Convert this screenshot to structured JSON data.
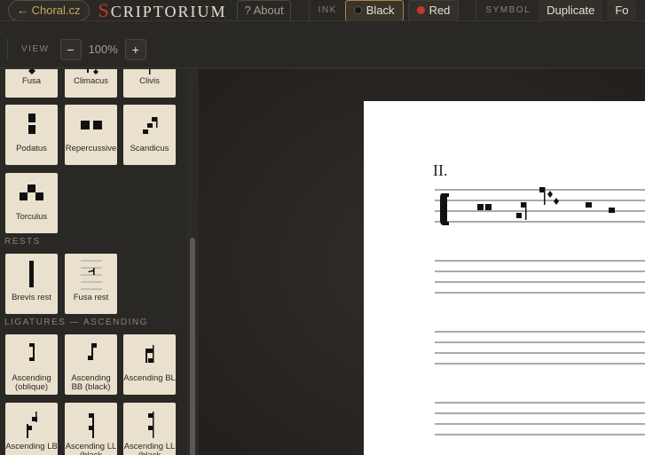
{
  "topbar": {
    "back_label": "← Choral.cz",
    "brand_first": "S",
    "brand_rest": "CRIPTORIUM",
    "about_label": "? About",
    "ink_label": "INK",
    "ink_black": "Black",
    "ink_red": "Red",
    "symbol_label": "SYMBOL",
    "duplicate_label": "Duplicate",
    "fo_label": "Fo"
  },
  "viewbar": {
    "view_label": "VIEW",
    "zoom_out": "−",
    "zoom_value": "100%",
    "zoom_in": "+"
  },
  "palette": {
    "neumes": [
      {
        "name": "Fusa",
        "icon": "fusa-icon"
      },
      {
        "name": "Climacus",
        "icon": "climacus-icon"
      },
      {
        "name": "Clivis",
        "icon": "clivis-icon"
      },
      {
        "name": "Podatus",
        "icon": "podatus-icon"
      },
      {
        "name": "Repercussive",
        "icon": "repercussive-icon"
      },
      {
        "name": "Scandicus",
        "icon": "scandicus-icon"
      },
      {
        "name": "Torculus",
        "icon": "torculus-icon"
      }
    ],
    "rests_label": "RESTS",
    "rests": [
      {
        "name": "Brevis rest",
        "icon": "brevis-rest-icon"
      },
      {
        "name": "Fusa rest",
        "icon": "fusa-rest-icon"
      }
    ],
    "ligatures_label": "LIGATURES — ASCENDING",
    "ligatures": [
      {
        "name": "Ascending (oblique)",
        "icon": "ligature-oblique-icon"
      },
      {
        "name": "Ascending BB (black)",
        "icon": "ligature-bb-icon"
      },
      {
        "name": "Ascending BL",
        "icon": "ligature-bl-icon"
      },
      {
        "name": "Ascending LB",
        "icon": "ligature-lb-icon"
      },
      {
        "name": "Ascending LL (black",
        "icon": "ligature-ll-black-icon"
      },
      {
        "name": "Ascending LL (black",
        "icon": "ligature-ll-black-2-icon"
      }
    ]
  },
  "sheet": {
    "section_label": "II."
  },
  "colors": {
    "accent": "#c9a65a",
    "brand_red": "#c0392b",
    "tile_bg": "#e9e1cd"
  }
}
